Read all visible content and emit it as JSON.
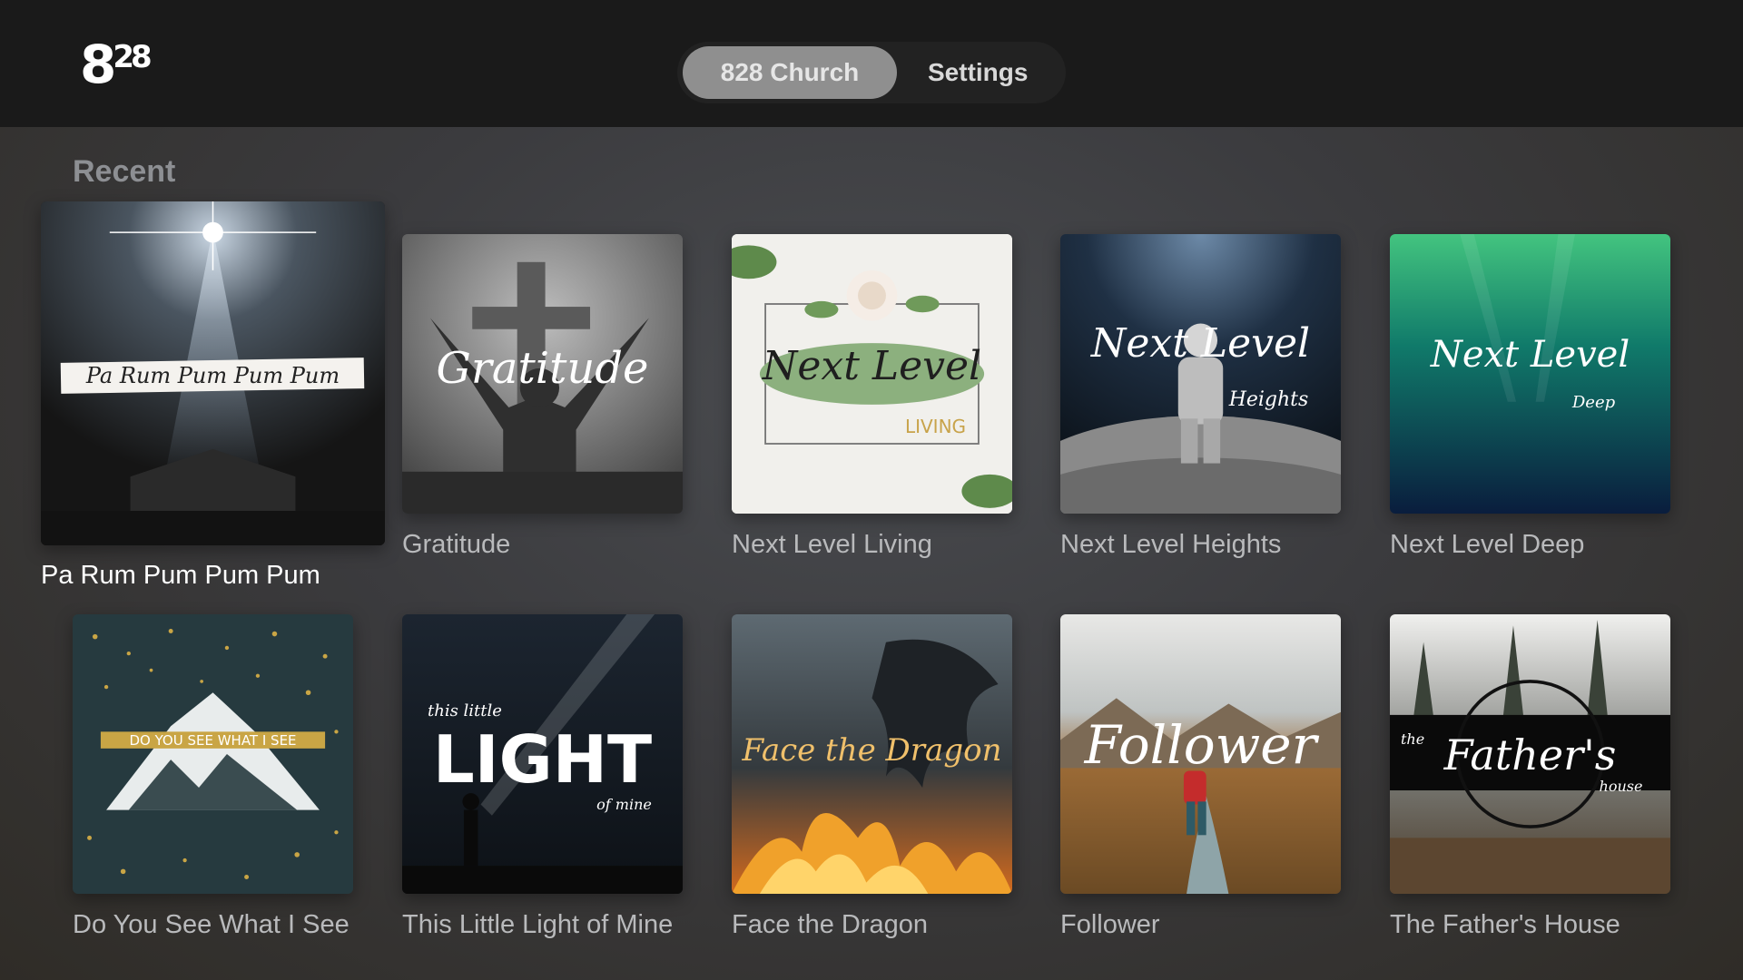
{
  "header": {
    "logo_main": "8",
    "logo_sup": "28",
    "tabs": [
      {
        "label": "828 Church",
        "active": true
      },
      {
        "label": "Settings",
        "active": false
      }
    ]
  },
  "section": {
    "title": "Recent"
  },
  "items": [
    {
      "title": "Pa Rum Pum Pum Pum",
      "art_text": "Pa Rum Pum Pum Pum",
      "focused": true
    },
    {
      "title": "Gratitude",
      "art_text": "Gratitude"
    },
    {
      "title": "Next Level Living",
      "art_text": "Next Level",
      "art_sub": "LIVING"
    },
    {
      "title": "Next Level Heights",
      "art_text": "Next Level",
      "art_sub": "Heights"
    },
    {
      "title": "Next Level Deep",
      "art_text": "Next Level",
      "art_sub": "Deep"
    },
    {
      "title": "Do You See What I See",
      "art_text": "DO YOU SEE WHAT I SEE"
    },
    {
      "title": "This Little Light of Mine",
      "art_pre": "this little",
      "art_text": "LIGHT",
      "art_sub": "of mine"
    },
    {
      "title": "Face the Dragon",
      "art_text": "Face the Dragon"
    },
    {
      "title": "Follower",
      "art_text": "Follower"
    },
    {
      "title": "The Father's House",
      "art_pre": "the",
      "art_text": "Father's",
      "art_sub": "house"
    }
  ],
  "colors": {
    "topbar": "#1a1a1a",
    "tab_active": "#8f8f8f",
    "section_title": "#8d8f93",
    "card_title": "#b9babc"
  }
}
